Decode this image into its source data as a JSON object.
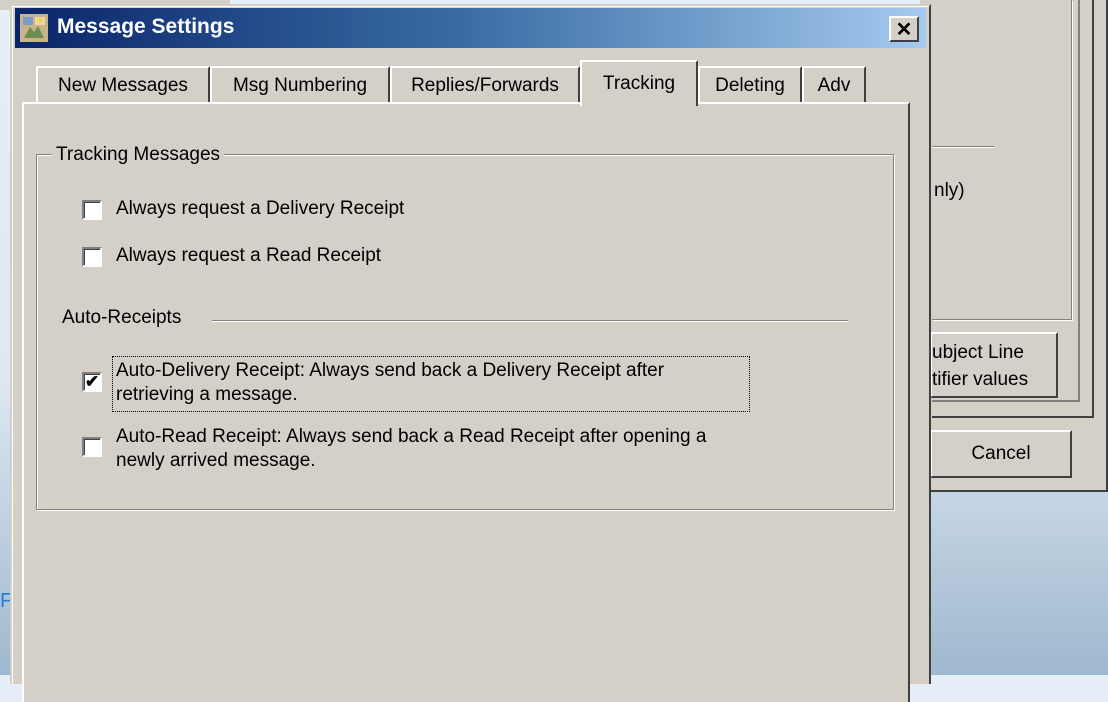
{
  "background_window": {
    "partial_text": "nly)",
    "subject_button_lines": [
      "ubject Line",
      "tifier values"
    ],
    "cancel_label": "Cancel",
    "left_edge_char": "F"
  },
  "dialog": {
    "title": "Message Settings",
    "close_glyph": "✕"
  },
  "tabs": [
    {
      "label": "New Messages",
      "active": false
    },
    {
      "label": "Msg Numbering",
      "active": false
    },
    {
      "label": "Replies/Forwards",
      "active": false
    },
    {
      "label": "Tracking",
      "active": true
    },
    {
      "label": "Deleting",
      "active": false
    },
    {
      "label": "Adv",
      "active": false
    }
  ],
  "tracking": {
    "group_title": "Tracking Messages",
    "options": [
      {
        "label": "Always request a Delivery Receipt",
        "checked": false
      },
      {
        "label": "Always request a Read Receipt",
        "checked": false
      }
    ],
    "auto_receipts_title": "Auto-Receipts",
    "auto_options": [
      {
        "line1": "Auto-Delivery Receipt:  Always send back a Delivery Receipt after",
        "line2": "retrieving a message.",
        "checked": true
      },
      {
        "line1": "Auto-Read Receipt:  Always send back a Read Receipt after opening a",
        "line2": "newly arrived message.",
        "checked": false
      }
    ]
  },
  "colors": {
    "face": "#d4d0c8",
    "title_start": "#0a246a",
    "title_end": "#a6caf0"
  }
}
